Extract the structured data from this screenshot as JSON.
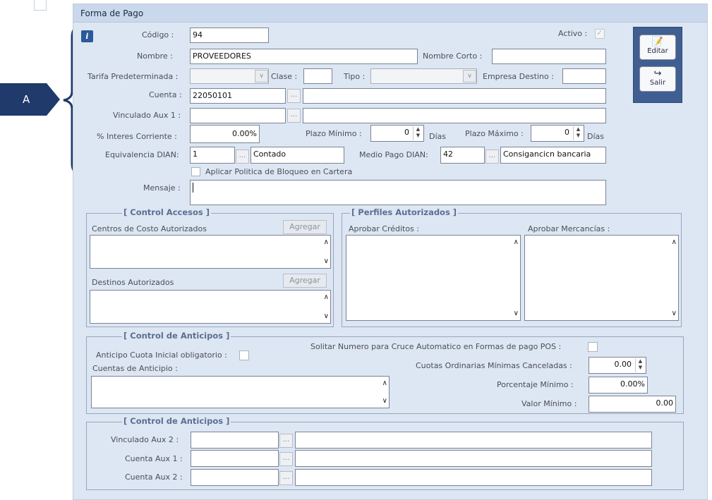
{
  "window": {
    "title": "Forma de Pago"
  },
  "callout": {
    "label": "A"
  },
  "toolbar": {
    "edit_label": "Editar",
    "exit_label": "Salir"
  },
  "form": {
    "codigo": {
      "label": "Código :",
      "value": "94"
    },
    "activo": {
      "label": "Activo :",
      "checked": true
    },
    "nombre": {
      "label": "Nombre :",
      "value": "PROVEEDORES"
    },
    "nombre_corto": {
      "label": "Nombre Corto :",
      "value": ""
    },
    "tarifa": {
      "label": "Tarifa Predeterminada :",
      "value": ""
    },
    "clase": {
      "label": "Clase :",
      "value": ""
    },
    "tipo": {
      "label": "Tipo :",
      "value": ""
    },
    "empresa_destino": {
      "label": "Empresa Destino :",
      "value": ""
    },
    "cuenta": {
      "label": "Cuenta :",
      "value": "22050101",
      "description": ""
    },
    "vinculado_aux1": {
      "label": "Vinculado Aux 1 :",
      "value": "",
      "description": ""
    },
    "interes": {
      "label": "% Interes Corriente :",
      "value": "0.00%"
    },
    "plazo_minimo": {
      "label": "Plazo Mínimo :",
      "value": "0",
      "unit": "Días"
    },
    "plazo_maximo": {
      "label": "Plazo Máximo :",
      "value": "0",
      "unit": "Días"
    },
    "equivalencia_dian": {
      "label": "Equivalencia DIAN:",
      "value": "1",
      "description": "Contado"
    },
    "medio_pago_dian": {
      "label": "Medio Pago DIAN:",
      "value": "42",
      "description": "Consigancicn bancaria"
    },
    "aplicar_politica": {
      "label": "Aplicar Politica de Bloqueo en Cartera",
      "checked": false
    },
    "mensaje": {
      "label": "Mensaje :",
      "value": ""
    }
  },
  "control_accesos": {
    "title": "[ Control Accesos ]",
    "centros_label": "Centros de Costo Autorizados",
    "destinos_label": "Destinos Autorizados",
    "agregar_label": "Agregar"
  },
  "perfiles": {
    "title": "[ Perfiles Autorizados ]",
    "aprobar_creditos_label": "Aprobar Créditos :",
    "aprobar_mercancias_label": "Aprobar Mercancías :"
  },
  "anticipos": {
    "title": "[ Control de Anticipos ]",
    "cuota_inicial_label": "Anticipo Cuota Inicial obligatorio :",
    "solicitar_label": "Solitar Numero para Cruce Automatico en Formas  de pago POS :",
    "cuentas_label": "Cuentas de Anticipio :",
    "cuotas_label": "Cuotas Ordinarias Mínimas Canceladas :",
    "cuotas_value": "0.00",
    "porcentaje_label": "Porcentaje Mínimo  :",
    "porcentaje_value": "0.00%",
    "valor_label": "Valor Mínimo :",
    "valor_value": "0.00"
  },
  "anticipos2": {
    "title": "[ Control de Anticipos ]",
    "vinculado_aux2_label": "Vinculado  Aux 2 :",
    "cuenta_aux1_label": "Cuenta Aux 1 :",
    "cuenta_aux2_label": "Cuenta Aux 2 :"
  },
  "colors": {
    "window_bg": "#dde6f3",
    "title_bar": "#c9d8ec",
    "toolbar_panel": "#3f5f93",
    "callout": "#1f3a6b"
  }
}
